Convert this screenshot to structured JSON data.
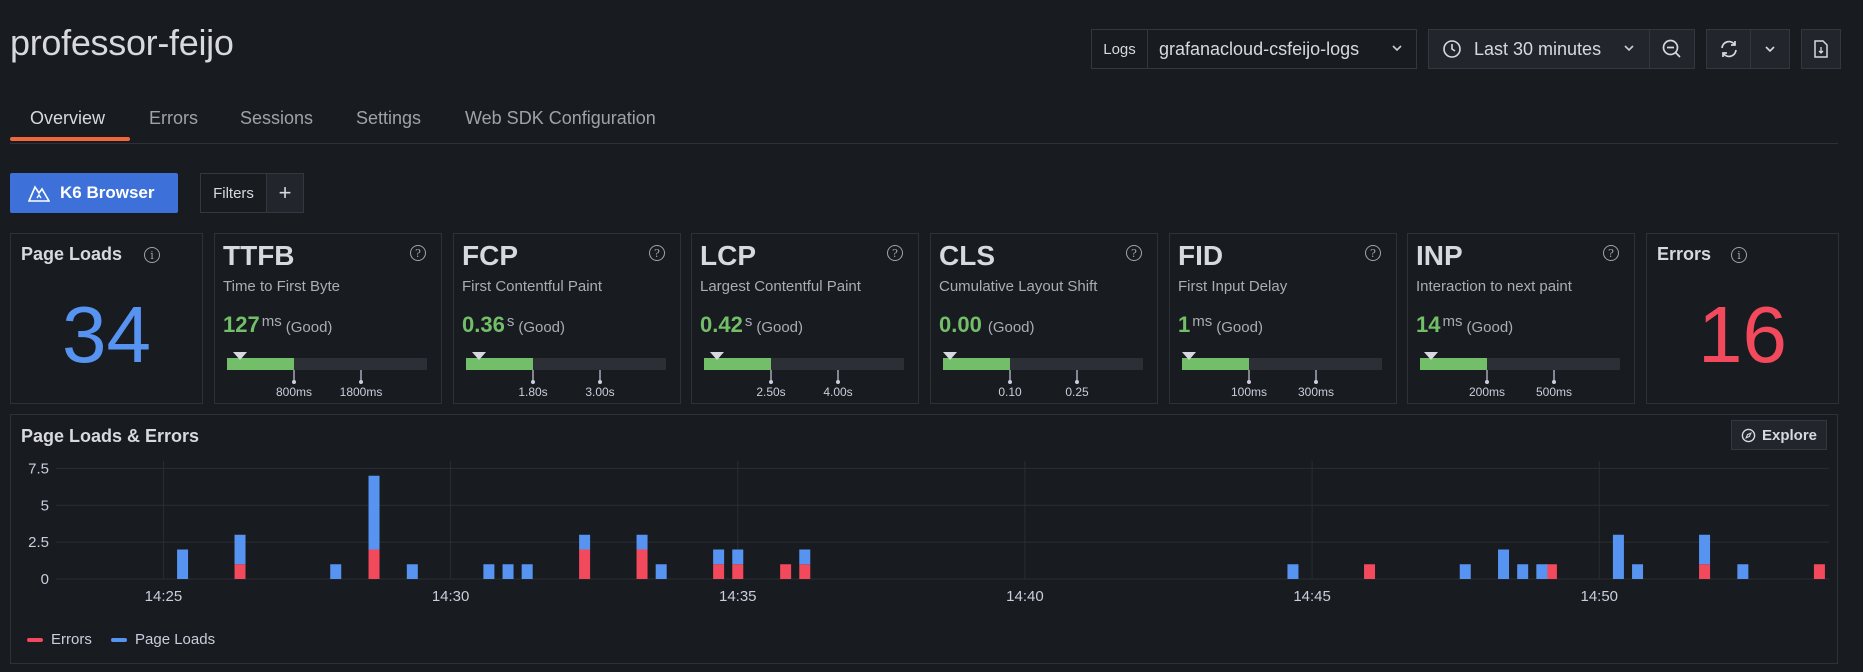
{
  "header": {
    "title": "professor-feijo",
    "datasource_label": "Logs",
    "datasource_value": "grafanacloud-csfeijo-logs",
    "time_range": "Last 30 minutes"
  },
  "tabs": [
    {
      "label": "Overview",
      "active": true
    },
    {
      "label": "Errors",
      "active": false
    },
    {
      "label": "Sessions",
      "active": false
    },
    {
      "label": "Settings",
      "active": false
    },
    {
      "label": "Web SDK Configuration",
      "active": false
    }
  ],
  "toolbar": {
    "k6_label": "K6 Browser",
    "filters_label": "Filters",
    "add_label": "+"
  },
  "stats": {
    "page_loads": {
      "title": "Page Loads",
      "value": "34",
      "color": "#5794f2"
    },
    "errors": {
      "title": "Errors",
      "value": "16",
      "color": "#f2495c"
    }
  },
  "vitals": [
    {
      "name": "TTFB",
      "subtitle": "Time to First Byte",
      "value": "127",
      "unit": "ms",
      "rating": "(Good)",
      "thresholds": [
        "800ms",
        "1800ms"
      ],
      "marker": 0.03
    },
    {
      "name": "FCP",
      "subtitle": "First Contentful Paint",
      "value": "0.36",
      "unit": "s",
      "rating": "(Good)",
      "thresholds": [
        "1.80s",
        "3.00s"
      ],
      "marker": 0.03
    },
    {
      "name": "LCP",
      "subtitle": "Largest Contentful Paint",
      "value": "0.42",
      "unit": "s",
      "rating": "(Good)",
      "thresholds": [
        "2.50s",
        "4.00s"
      ],
      "marker": 0.03
    },
    {
      "name": "CLS",
      "subtitle": "Cumulative Layout Shift",
      "value": "0.00",
      "unit": "",
      "rating": "(Good)",
      "thresholds": [
        "0.10",
        "0.25"
      ],
      "marker": 0.0
    },
    {
      "name": "FID",
      "subtitle": "First Input Delay",
      "value": "1",
      "unit": "ms",
      "rating": "(Good)",
      "thresholds": [
        "100ms",
        "300ms"
      ],
      "marker": 0.0
    },
    {
      "name": "INP",
      "subtitle": "Interaction to next paint",
      "value": "14",
      "unit": "ms",
      "rating": "(Good)",
      "thresholds": [
        "200ms",
        "500ms"
      ],
      "marker": 0.02
    }
  ],
  "chart_panel": {
    "title": "Page Loads & Errors",
    "explore_label": "Explore"
  },
  "colors": {
    "good": "#73bf69",
    "errors": "#f2495c",
    "page_loads": "#5794f2",
    "accent": "#f0673c",
    "primary_button": "#3d71d9"
  },
  "chart_data": {
    "type": "bar",
    "stacked": true,
    "title": "Page Loads & Errors",
    "x_unit": "minutes",
    "x_ticks": [
      "14:25",
      "14:30",
      "14:35",
      "14:40",
      "14:45",
      "14:50"
    ],
    "y_ticks": [
      "0",
      "2.5",
      "5",
      "7.5"
    ],
    "ylim": [
      0,
      8
    ],
    "xlim": [
      "14:24",
      "14:54"
    ],
    "grid": true,
    "legend_position": "bottom-left",
    "series": [
      {
        "name": "Errors",
        "color": "#f2495c",
        "points": [
          {
            "x": "14:26:20",
            "y": 1
          },
          {
            "x": "14:28:40",
            "y": 2
          },
          {
            "x": "14:32:20",
            "y": 2
          },
          {
            "x": "14:33:20",
            "y": 2
          },
          {
            "x": "14:34:40",
            "y": 1
          },
          {
            "x": "14:35:00",
            "y": 1
          },
          {
            "x": "14:35:50",
            "y": 1
          },
          {
            "x": "14:36:10",
            "y": 1
          },
          {
            "x": "14:46:00",
            "y": 1
          },
          {
            "x": "14:49:10",
            "y": 1
          },
          {
            "x": "14:51:50",
            "y": 1
          },
          {
            "x": "14:53:50",
            "y": 1
          }
        ]
      },
      {
        "name": "Page Loads",
        "color": "#5794f2",
        "points": [
          {
            "x": "14:25:20",
            "y": 2
          },
          {
            "x": "14:26:20",
            "y": 2
          },
          {
            "x": "14:28:00",
            "y": 1
          },
          {
            "x": "14:28:40",
            "y": 5
          },
          {
            "x": "14:29:20",
            "y": 1
          },
          {
            "x": "14:30:40",
            "y": 1
          },
          {
            "x": "14:31:00",
            "y": 1
          },
          {
            "x": "14:31:20",
            "y": 1
          },
          {
            "x": "14:32:20",
            "y": 1
          },
          {
            "x": "14:33:20",
            "y": 1
          },
          {
            "x": "14:33:40",
            "y": 1
          },
          {
            "x": "14:34:40",
            "y": 1
          },
          {
            "x": "14:35:00",
            "y": 1
          },
          {
            "x": "14:36:10",
            "y": 1
          },
          {
            "x": "14:44:40",
            "y": 1
          },
          {
            "x": "14:47:40",
            "y": 1
          },
          {
            "x": "14:48:20",
            "y": 2
          },
          {
            "x": "14:48:40",
            "y": 1
          },
          {
            "x": "14:49:00",
            "y": 1
          },
          {
            "x": "14:50:20",
            "y": 3
          },
          {
            "x": "14:50:40",
            "y": 1
          },
          {
            "x": "14:51:50",
            "y": 2
          },
          {
            "x": "14:52:30",
            "y": 1
          }
        ]
      }
    ]
  }
}
